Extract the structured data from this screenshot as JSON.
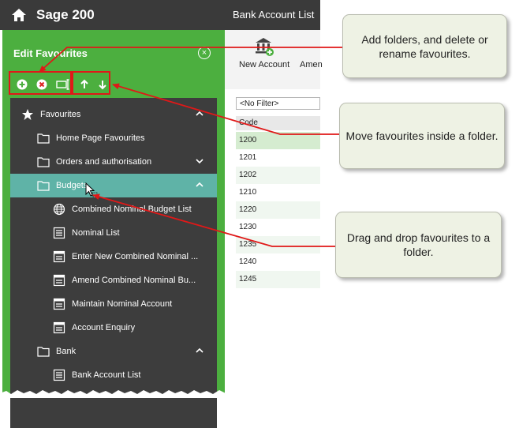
{
  "window": {
    "app_title": "Sage 200",
    "window_title": "Bank Account List"
  },
  "panel": {
    "title": "Edit Favourites",
    "toolbar": {
      "add_icon": "add-circle-icon",
      "delete_icon": "delete-circle-icon",
      "rename_icon": "rename-icon",
      "move_up_icon": "arrow-up-icon",
      "move_down_icon": "arrow-down-icon"
    },
    "tree": [
      {
        "label": "Favourites",
        "icon": "star-icon",
        "chevron": "up"
      },
      {
        "label": "Home Page Favourites",
        "icon": "folder-icon"
      },
      {
        "label": "Orders and authorisation",
        "icon": "folder-icon",
        "chevron": "down"
      },
      {
        "label": "Budgets",
        "icon": "folder-icon",
        "chevron": "up",
        "selected": true
      },
      {
        "label": "Combined Nominal Budget List",
        "icon": "globe-icon"
      },
      {
        "label": "Nominal List",
        "icon": "list-icon"
      },
      {
        "label": "Enter New Combined Nominal ...",
        "icon": "form-icon"
      },
      {
        "label": "Amend Combined Nominal Bu...",
        "icon": "form-icon"
      },
      {
        "label": "Maintain Nominal Account",
        "icon": "form-icon"
      },
      {
        "label": "Account Enquiry",
        "icon": "form-icon"
      },
      {
        "label": "Bank",
        "icon": "folder-icon",
        "chevron": "up"
      },
      {
        "label": "Bank Account List",
        "icon": "list-icon"
      }
    ]
  },
  "ribbon": {
    "new_account": "New Account",
    "amend": "Amen"
  },
  "list": {
    "filter": "<No Filter>",
    "column": "Code",
    "rows": [
      "1200",
      "1201",
      "1202",
      "1210",
      "1220",
      "1230",
      "1235",
      "1240",
      "1245"
    ]
  },
  "callouts": {
    "add_folders": "Add folders, and delete or rename favourites.",
    "move": "Move favourites inside a folder.",
    "drag": "Drag and drop favourites to a folder."
  },
  "colors": {
    "panel_green": "#4caf3f",
    "tree_bg": "#3d3d3d",
    "selected": "#5fb3a7",
    "annotation_red": "#e01818"
  }
}
